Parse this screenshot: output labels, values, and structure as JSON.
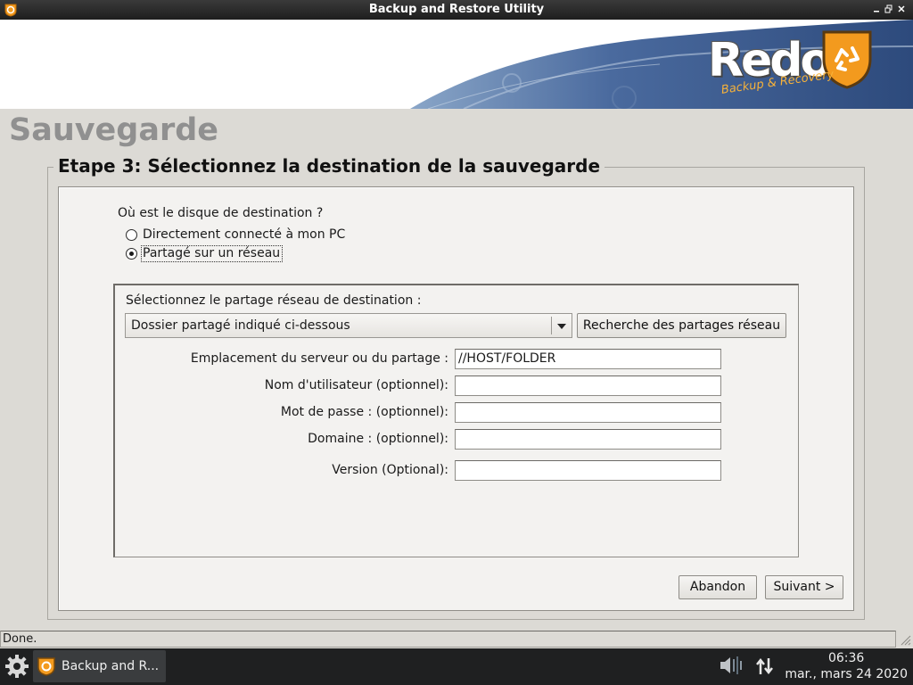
{
  "window": {
    "title": "Backup and Restore Utility",
    "controls": [
      "minimize",
      "restore",
      "close"
    ]
  },
  "banner": {
    "logo_text": "Redo",
    "logo_tagline": "Backup & Recovery"
  },
  "page": {
    "title": "Sauvegarde",
    "step_heading": "Etape 3: Sélectionnez la destination de la sauvegarde"
  },
  "destination": {
    "question": "Où est le disque de destination ?",
    "options": [
      {
        "label": "Directement connecté à mon PC",
        "selected": false
      },
      {
        "label": "Partagé sur un réseau",
        "selected": true
      }
    ]
  },
  "network": {
    "prompt": "Sélectionnez le partage réseau de destination :",
    "share_select_value": "Dossier partagé indiqué ci-dessous",
    "browse_button": "Recherche des partages réseau",
    "fields": {
      "server": {
        "label": "Emplacement du serveur ou du partage :",
        "value": "//HOST/FOLDER"
      },
      "username": {
        "label": "Nom d'utilisateur (optionnel):",
        "value": ""
      },
      "password": {
        "label": "Mot de passe : (optionnel):",
        "value": ""
      },
      "domain": {
        "label": "Domaine : (optionnel):",
        "value": ""
      },
      "version": {
        "label": "Version (Optional):",
        "value": ""
      }
    }
  },
  "actions": {
    "cancel": "Abandon",
    "next": "Suivant >"
  },
  "status": {
    "text": "Done."
  },
  "taskbar": {
    "task_label": "Backup and R...",
    "time": "06:36",
    "date": "mar., mars 24 2020"
  },
  "colors": {
    "title_bar": "#2a2a2a",
    "logo_orange": "#f39a1e",
    "banner_blue": "#3f5f93",
    "page_title": "#909090"
  }
}
